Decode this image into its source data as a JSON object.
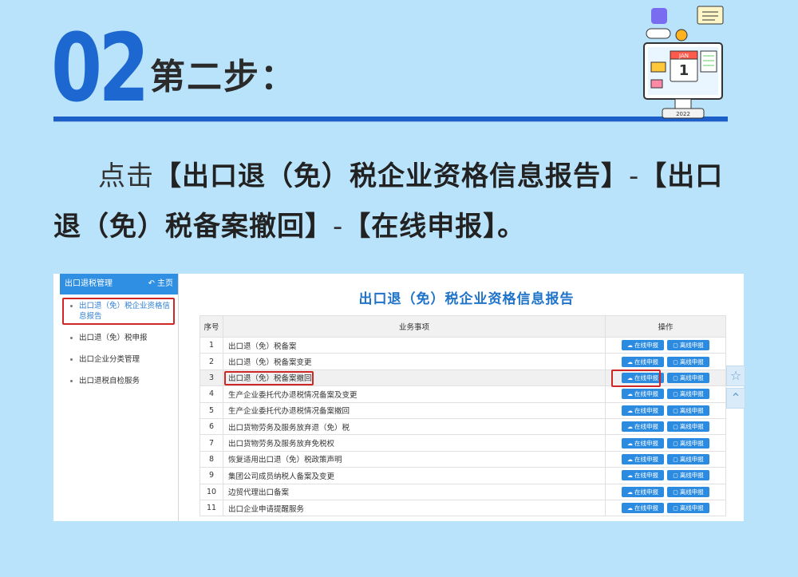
{
  "header": {
    "step_number": "02",
    "step_title": "第二步："
  },
  "instruction": {
    "prefix": "点击",
    "part1": "【出口退（免）税企业资格信息报告】",
    "sep1": "-",
    "part2": "【出口退（免）税备案撤回】",
    "sep2": "-",
    "part3": "【在线申报】",
    "suffix": "。"
  },
  "sidebar": {
    "title": "出口退税管理",
    "home_label": "主页",
    "items": [
      {
        "label": "出口退（免）税企业资格信息报告"
      },
      {
        "label": "出口退（免）税申报"
      },
      {
        "label": "出口企业分类管理"
      },
      {
        "label": "出口退税自检服务"
      }
    ]
  },
  "main": {
    "title": "出口退（免）税企业资格信息报告",
    "columns": [
      "序号",
      "业务事项",
      "操作"
    ],
    "online_label": "在线申报",
    "offline_label": "离线申报",
    "rows": [
      {
        "seq": "1",
        "item": "出口退（免）税备案"
      },
      {
        "seq": "2",
        "item": "出口退（免）税备案变更"
      },
      {
        "seq": "3",
        "item": "出口退（免）税备案撤回"
      },
      {
        "seq": "4",
        "item": "生产企业委托代办退税情况备案及变更"
      },
      {
        "seq": "5",
        "item": "生产企业委托代办退税情况备案撤回"
      },
      {
        "seq": "6",
        "item": "出口货物劳务及服务放弃退（免）税"
      },
      {
        "seq": "7",
        "item": "出口货物劳务及服务放弃免税权"
      },
      {
        "seq": "8",
        "item": "恢复适用出口退（免）税政策声明"
      },
      {
        "seq": "9",
        "item": "集团公司成员纳税人备案及变更"
      },
      {
        "seq": "10",
        "item": "边贸代理出口备案"
      },
      {
        "seq": "11",
        "item": "出口企业申请提醒服务"
      }
    ]
  },
  "colors": {
    "background": "#b9e3fb",
    "accent_blue": "#1d67d1",
    "button_blue": "#2b8be0",
    "highlight_red": "#d12626"
  },
  "illustration": {
    "calendar_month": "JAN",
    "calendar_day": "1",
    "year": "2022"
  }
}
